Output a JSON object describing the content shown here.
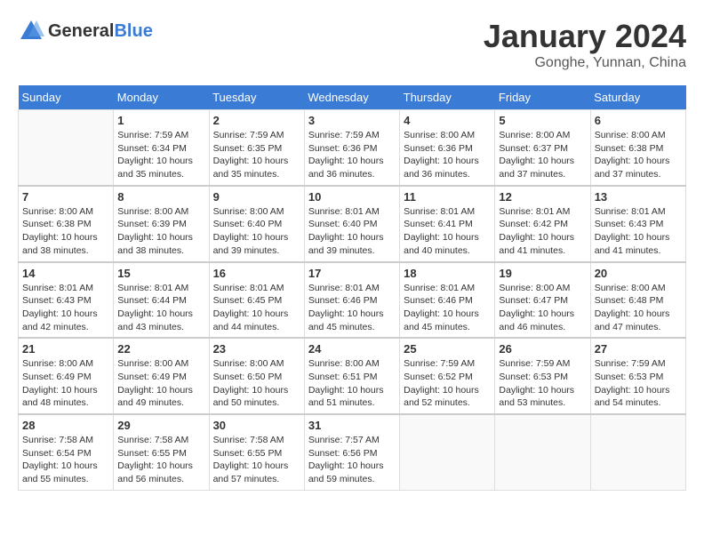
{
  "logo": {
    "general": "General",
    "blue": "Blue"
  },
  "header": {
    "month": "January 2024",
    "location": "Gonghe, Yunnan, China"
  },
  "weekdays": [
    "Sunday",
    "Monday",
    "Tuesday",
    "Wednesday",
    "Thursday",
    "Friday",
    "Saturday"
  ],
  "weeks": [
    [
      {
        "day": "",
        "info": ""
      },
      {
        "day": "1",
        "info": "Sunrise: 7:59 AM\nSunset: 6:34 PM\nDaylight: 10 hours\nand 35 minutes."
      },
      {
        "day": "2",
        "info": "Sunrise: 7:59 AM\nSunset: 6:35 PM\nDaylight: 10 hours\nand 35 minutes."
      },
      {
        "day": "3",
        "info": "Sunrise: 7:59 AM\nSunset: 6:36 PM\nDaylight: 10 hours\nand 36 minutes."
      },
      {
        "day": "4",
        "info": "Sunrise: 8:00 AM\nSunset: 6:36 PM\nDaylight: 10 hours\nand 36 minutes."
      },
      {
        "day": "5",
        "info": "Sunrise: 8:00 AM\nSunset: 6:37 PM\nDaylight: 10 hours\nand 37 minutes."
      },
      {
        "day": "6",
        "info": "Sunrise: 8:00 AM\nSunset: 6:38 PM\nDaylight: 10 hours\nand 37 minutes."
      }
    ],
    [
      {
        "day": "7",
        "info": "Sunrise: 8:00 AM\nSunset: 6:38 PM\nDaylight: 10 hours\nand 38 minutes."
      },
      {
        "day": "8",
        "info": "Sunrise: 8:00 AM\nSunset: 6:39 PM\nDaylight: 10 hours\nand 38 minutes."
      },
      {
        "day": "9",
        "info": "Sunrise: 8:00 AM\nSunset: 6:40 PM\nDaylight: 10 hours\nand 39 minutes."
      },
      {
        "day": "10",
        "info": "Sunrise: 8:01 AM\nSunset: 6:40 PM\nDaylight: 10 hours\nand 39 minutes."
      },
      {
        "day": "11",
        "info": "Sunrise: 8:01 AM\nSunset: 6:41 PM\nDaylight: 10 hours\nand 40 minutes."
      },
      {
        "day": "12",
        "info": "Sunrise: 8:01 AM\nSunset: 6:42 PM\nDaylight: 10 hours\nand 41 minutes."
      },
      {
        "day": "13",
        "info": "Sunrise: 8:01 AM\nSunset: 6:43 PM\nDaylight: 10 hours\nand 41 minutes."
      }
    ],
    [
      {
        "day": "14",
        "info": "Sunrise: 8:01 AM\nSunset: 6:43 PM\nDaylight: 10 hours\nand 42 minutes."
      },
      {
        "day": "15",
        "info": "Sunrise: 8:01 AM\nSunset: 6:44 PM\nDaylight: 10 hours\nand 43 minutes."
      },
      {
        "day": "16",
        "info": "Sunrise: 8:01 AM\nSunset: 6:45 PM\nDaylight: 10 hours\nand 44 minutes."
      },
      {
        "day": "17",
        "info": "Sunrise: 8:01 AM\nSunset: 6:46 PM\nDaylight: 10 hours\nand 45 minutes."
      },
      {
        "day": "18",
        "info": "Sunrise: 8:01 AM\nSunset: 6:46 PM\nDaylight: 10 hours\nand 45 minutes."
      },
      {
        "day": "19",
        "info": "Sunrise: 8:00 AM\nSunset: 6:47 PM\nDaylight: 10 hours\nand 46 minutes."
      },
      {
        "day": "20",
        "info": "Sunrise: 8:00 AM\nSunset: 6:48 PM\nDaylight: 10 hours\nand 47 minutes."
      }
    ],
    [
      {
        "day": "21",
        "info": "Sunrise: 8:00 AM\nSunset: 6:49 PM\nDaylight: 10 hours\nand 48 minutes."
      },
      {
        "day": "22",
        "info": "Sunrise: 8:00 AM\nSunset: 6:49 PM\nDaylight: 10 hours\nand 49 minutes."
      },
      {
        "day": "23",
        "info": "Sunrise: 8:00 AM\nSunset: 6:50 PM\nDaylight: 10 hours\nand 50 minutes."
      },
      {
        "day": "24",
        "info": "Sunrise: 8:00 AM\nSunset: 6:51 PM\nDaylight: 10 hours\nand 51 minutes."
      },
      {
        "day": "25",
        "info": "Sunrise: 7:59 AM\nSunset: 6:52 PM\nDaylight: 10 hours\nand 52 minutes."
      },
      {
        "day": "26",
        "info": "Sunrise: 7:59 AM\nSunset: 6:53 PM\nDaylight: 10 hours\nand 53 minutes."
      },
      {
        "day": "27",
        "info": "Sunrise: 7:59 AM\nSunset: 6:53 PM\nDaylight: 10 hours\nand 54 minutes."
      }
    ],
    [
      {
        "day": "28",
        "info": "Sunrise: 7:58 AM\nSunset: 6:54 PM\nDaylight: 10 hours\nand 55 minutes."
      },
      {
        "day": "29",
        "info": "Sunrise: 7:58 AM\nSunset: 6:55 PM\nDaylight: 10 hours\nand 56 minutes."
      },
      {
        "day": "30",
        "info": "Sunrise: 7:58 AM\nSunset: 6:55 PM\nDaylight: 10 hours\nand 57 minutes."
      },
      {
        "day": "31",
        "info": "Sunrise: 7:57 AM\nSunset: 6:56 PM\nDaylight: 10 hours\nand 59 minutes."
      },
      {
        "day": "",
        "info": ""
      },
      {
        "day": "",
        "info": ""
      },
      {
        "day": "",
        "info": ""
      }
    ]
  ]
}
